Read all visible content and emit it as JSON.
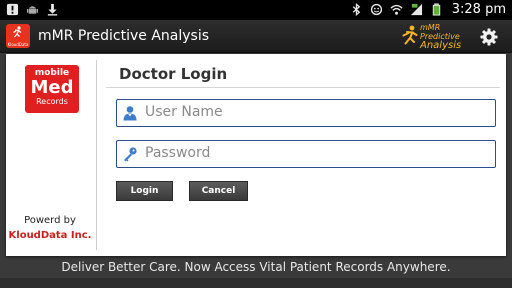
{
  "status_bar": {
    "time": "3:28 pm",
    "left_icons": [
      "alert-icon",
      "usb-debugging-icon",
      "download-icon"
    ],
    "right_icons": [
      "bluetooth-icon",
      "do-not-disturb-icon",
      "wifi-icon",
      "signal-icon",
      "battery-icon"
    ]
  },
  "action_bar": {
    "logo_caption": "KloudData",
    "title": "mMR Predictive Analysis",
    "brand_line1": "mMR Predictive",
    "brand_line2": "Analysis",
    "settings_icon": "gear-icon"
  },
  "sidebar": {
    "logo_line1": "mobile",
    "logo_line2": "Med",
    "logo_line3": "Records",
    "powered_by": "Powerd by",
    "company": "KloudData Inc."
  },
  "login": {
    "title": "Doctor Login",
    "username_placeholder": "User Name",
    "password_placeholder": "Password",
    "login_label": "Login",
    "cancel_label": "Cancel"
  },
  "footer": {
    "tagline": "Deliver Better Care. Now Access Vital Patient Records Anywhere."
  },
  "colors": {
    "brand_red": "#e02020",
    "brand_orange": "#f6b523",
    "field_border": "#2b4e8a"
  }
}
